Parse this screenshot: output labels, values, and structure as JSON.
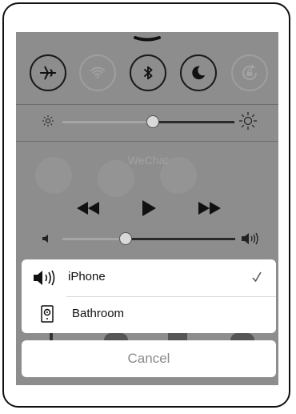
{
  "control_center": {
    "toggles": [
      {
        "name": "airplane-mode",
        "icon": "airplane-icon",
        "active": true
      },
      {
        "name": "wifi",
        "icon": "wifi-icon",
        "active": false
      },
      {
        "name": "bluetooth",
        "icon": "bluetooth-icon",
        "active": true
      },
      {
        "name": "do-not-disturb",
        "icon": "moon-icon",
        "active": true
      },
      {
        "name": "rotation-lock",
        "icon": "rotation-lock-icon",
        "active": false
      }
    ],
    "brightness": {
      "level": 0.52,
      "icons": [
        "sun-small-icon",
        "sun-large-icon"
      ]
    },
    "now_playing": {
      "app": "WeChat"
    },
    "volume": {
      "level": 0.36,
      "icons": [
        "speaker-low-icon",
        "speaker-high-icon"
      ]
    }
  },
  "airplay_sheet": {
    "devices": [
      {
        "label": "iPhone",
        "icon": "speaker-icon",
        "selected": true
      },
      {
        "label": "Bathroom",
        "icon": "airplay-speaker-icon",
        "selected": false
      }
    ],
    "cancel_label": "Cancel"
  },
  "colors": {
    "dim_overlay": "#8d8d8d",
    "sheet": "#ffffff",
    "cancel_text": "#8a8a8a"
  }
}
